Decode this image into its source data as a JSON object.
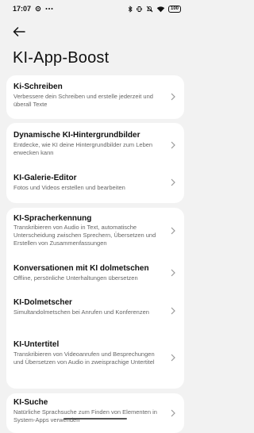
{
  "status_bar": {
    "time": "17:07",
    "battery": "100"
  },
  "header": {
    "title": "KI-App-Boost"
  },
  "cards": [
    {
      "items": [
        {
          "title": "Ki-Schreiben",
          "description": "Verbessere dein Schreiben und erstelle jederzeit und überall Texte"
        }
      ]
    },
    {
      "items": [
        {
          "title": "Dynamische KI-Hintergrundbilder",
          "description": "Entdecke, wie KI deine Hintergrundbilder zum Leben erwecken kann"
        },
        {
          "title": "KI-Galerie-Editor",
          "description": "Fotos und Videos erstellen und bearbeiten"
        }
      ]
    },
    {
      "items": [
        {
          "title": "KI-Spracherkennung",
          "description": "Transkribieren von Audio in Text, automatische Unterscheidung zwischen Sprechern, Übersetzen und Erstellen von Zusammenfassungen"
        },
        {
          "title": "Konversationen mit KI dolmetschen",
          "description": "Offline, persönliche Unterhaltungen übersetzen"
        },
        {
          "title": "KI-Dolmetscher",
          "description": "Simultandolmetschen bei Anrufen und Konferenzen"
        },
        {
          "title": "KI-Untertitel",
          "description": "Transkribieren von Videoanrufen und Besprechungen und Übersetzen von Audio in zweisprachige Untertitel"
        }
      ]
    },
    {
      "items": [
        {
          "title": "KI-Suche",
          "description": "Natürliche Sprachsuche zum Finden von Elementen in System-Apps verwenden"
        }
      ]
    }
  ]
}
